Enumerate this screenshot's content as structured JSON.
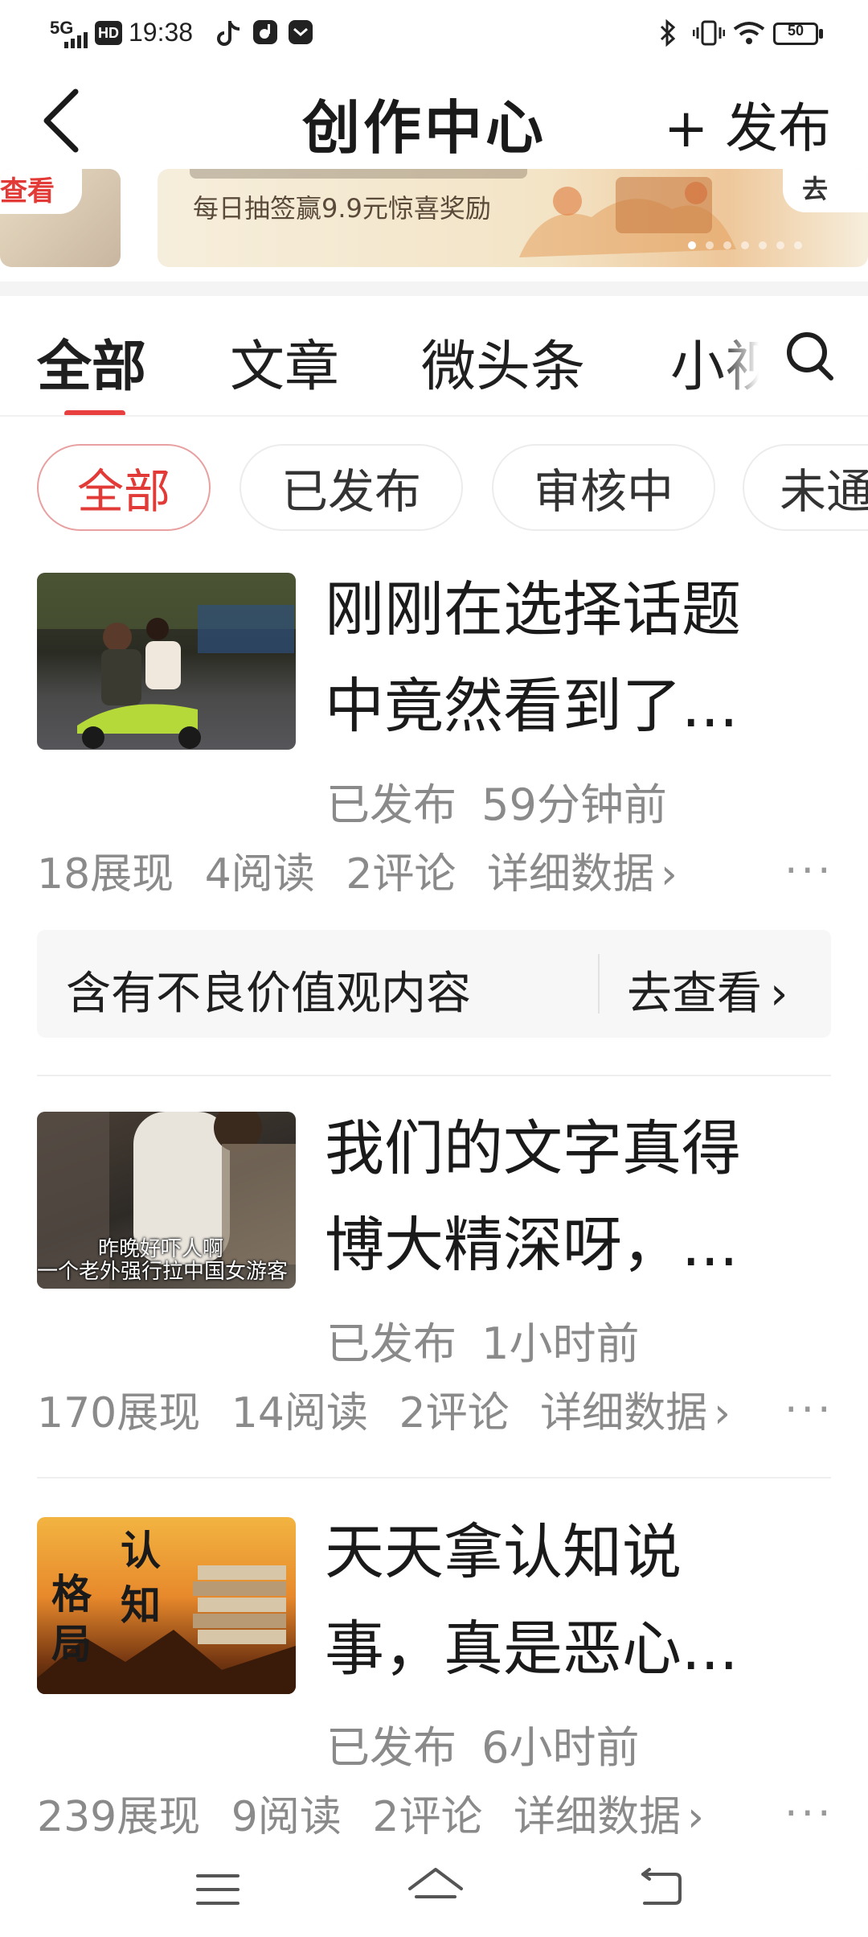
{
  "status_bar": {
    "network": "5G",
    "hd": "HD",
    "time": "19:38",
    "battery": "50"
  },
  "header": {
    "title": "创作中心",
    "publish_label": "+ 发布"
  },
  "banner": {
    "left_fragment": "查看",
    "subtitle": "每日抽签赢9.9元惊喜奖励",
    "right_fragment": "去",
    "dots_total": 7,
    "dots_active_index": 0
  },
  "tabs": [
    {
      "label": "全部",
      "active": true
    },
    {
      "label": "文章"
    },
    {
      "label": "微头条"
    },
    {
      "label": "小视"
    }
  ],
  "filters": [
    {
      "label": "全部",
      "active": true
    },
    {
      "label": "已发布"
    },
    {
      "label": "审核中"
    },
    {
      "label": "未通"
    }
  ],
  "articles": [
    {
      "title_line1": "刚刚在选择话题",
      "title_line2": "中竟然看到了...",
      "status": "已发布",
      "time": "59分钟前",
      "impressions": "18展现",
      "reads": "4阅读",
      "comments": "2评论",
      "details": "详细数据",
      "warning": {
        "text": "含有不良价值观内容",
        "action": "去查看"
      }
    },
    {
      "title_line1": "我们的文字真得",
      "title_line2": "博大精深呀，...",
      "status": "已发布",
      "time": "1小时前",
      "impressions": "170展现",
      "reads": "14阅读",
      "comments": "2评论",
      "details": "详细数据",
      "thumb_caption1": "昨晚好吓人啊",
      "thumb_caption2": "一个老外强行拉中国女游客"
    },
    {
      "title_line1": "天天拿认知说",
      "title_line2": "事，真是恶心...",
      "status": "已发布",
      "time": "6小时前",
      "impressions": "239展现",
      "reads": "9阅读",
      "comments": "2评论",
      "details": "详细数据",
      "thumb_text": [
        "格",
        "局",
        "认",
        "知"
      ]
    }
  ],
  "more_glyph": "...",
  "chevron": "›",
  "colors": {
    "accent": "#e23a36",
    "muted_text": "#8a8a8a",
    "warning_bg": "#f7f7f7"
  }
}
